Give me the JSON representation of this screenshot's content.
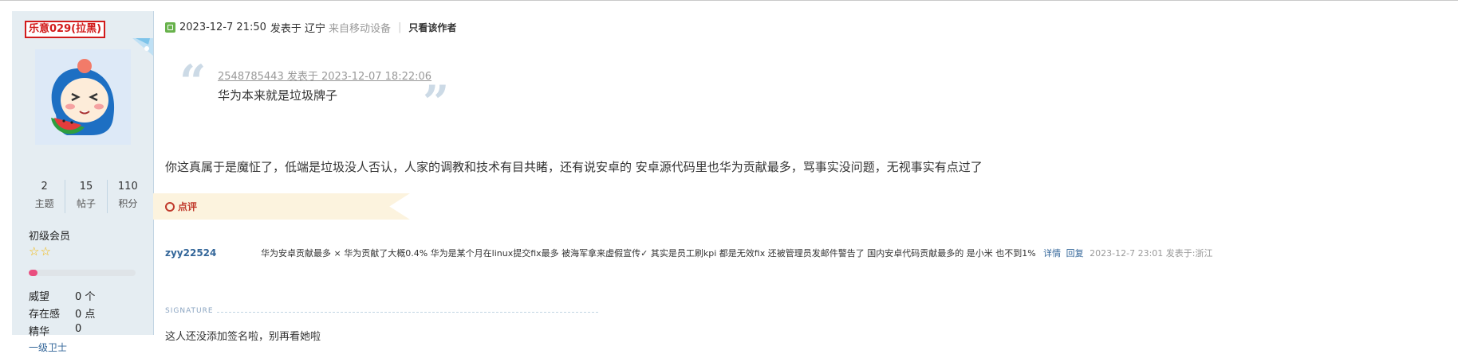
{
  "user": {
    "name": "乐意029(拉黑)",
    "stats": [
      {
        "value": "2",
        "label": "主题"
      },
      {
        "value": "15",
        "label": "帖子"
      },
      {
        "value": "110",
        "label": "积分"
      }
    ],
    "level": "初级会员",
    "stars": "☆☆",
    "progress_fraction": 0.08,
    "attrs": [
      {
        "key": "威望",
        "value": "0 个"
      },
      {
        "key": "存在感",
        "value": "0 点"
      },
      {
        "key": "精华",
        "value": "0"
      }
    ],
    "more": "一级卫士"
  },
  "post": {
    "datetime": "2023-12-7 21:50",
    "posted_in": "发表于 辽宁",
    "device": "来自移动设备",
    "separator": "|",
    "only_author": "只看该作者",
    "quote": {
      "open": "“",
      "close": "”",
      "source": "2548785443 发表于 2023-12-07 18:22:06",
      "text": "华为本来就是垃圾牌子"
    },
    "body": "你这真属于是魔怔了，低端是垃圾没人否认，人家的调教和技术有目共睹，还有说安卓的 安卓源代码里也华为贡献最多，骂事实没问题，无视事实有点过了"
  },
  "rating": {
    "label": "点评",
    "review": {
      "user": "zyy22524",
      "text": "华为安卓贡献最多 × 华为贡献了大概0.4% 华为是某个月在linux提交fix最多 被海军拿来虚假宣传✓ 其实是员工刷kpi 都是无效fix 还被管理员发邮件警告了 国内安卓代码贡献最多的 是小米 也不到1%",
      "detail": "详情",
      "reply": "回复",
      "date": "2023-12-7 23:01 发表于:浙江"
    }
  },
  "signature": {
    "label": "SIGNATURE",
    "text": "这人还没添加签名啦，别再看她啦"
  },
  "colors": {
    "sidebar_bg": "#e5edf2",
    "name_red": "#d21b1b",
    "link_blue": "#336699",
    "rating_band": "#fcf3de",
    "quote_mark": "#ccdae6"
  },
  "icons": [
    "corner-flag-icon",
    "avatar-image",
    "star-icon",
    "post-time-icon",
    "quote-open-icon",
    "quote-close-icon",
    "rating-circle-icon"
  ]
}
